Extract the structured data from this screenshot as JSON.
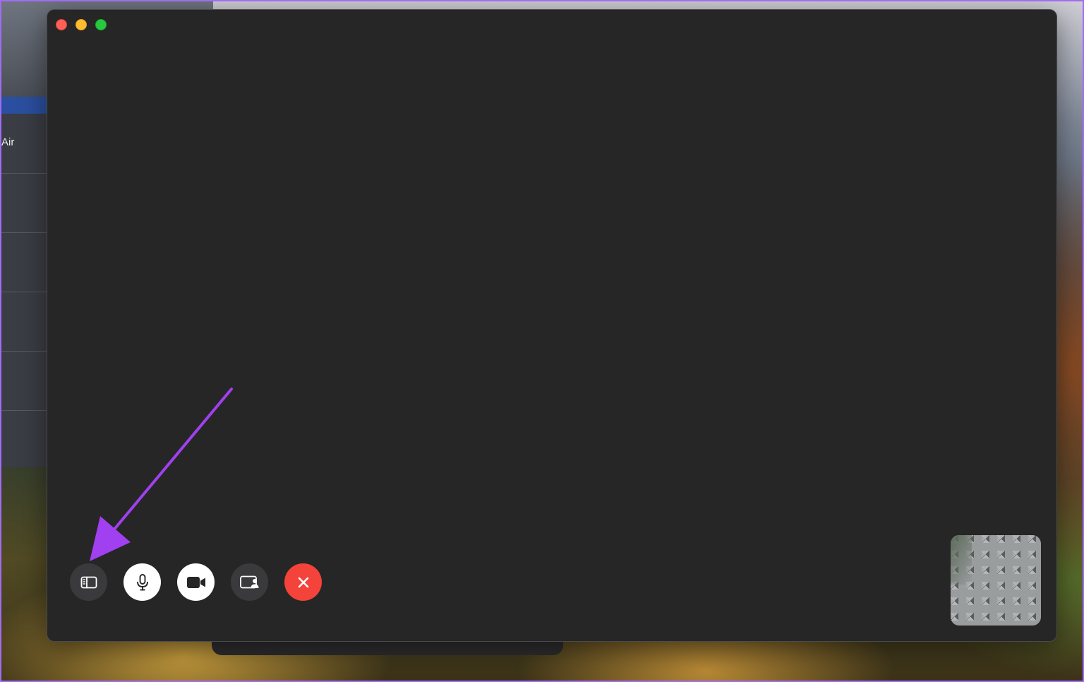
{
  "background_window": {
    "label": "Air"
  },
  "facetime_window": {
    "traffic_lights": [
      "close",
      "minimize",
      "zoom"
    ],
    "controls": [
      {
        "name": "sidebar-button",
        "icon": "sidebar-icon",
        "style": "dark"
      },
      {
        "name": "mute-button",
        "icon": "microphone-icon",
        "style": "light"
      },
      {
        "name": "camera-button",
        "icon": "video-camera-icon",
        "style": "light"
      },
      {
        "name": "share-screen-button",
        "icon": "screen-share-icon",
        "style": "dark"
      },
      {
        "name": "end-call-button",
        "icon": "close-icon",
        "style": "end"
      }
    ],
    "self_view": "camera-preview"
  },
  "colors": {
    "window_bg": "#262626",
    "end_call": "#f4433a",
    "annotation_arrow": "#a040f0",
    "frame_border": "#a36cf2"
  }
}
